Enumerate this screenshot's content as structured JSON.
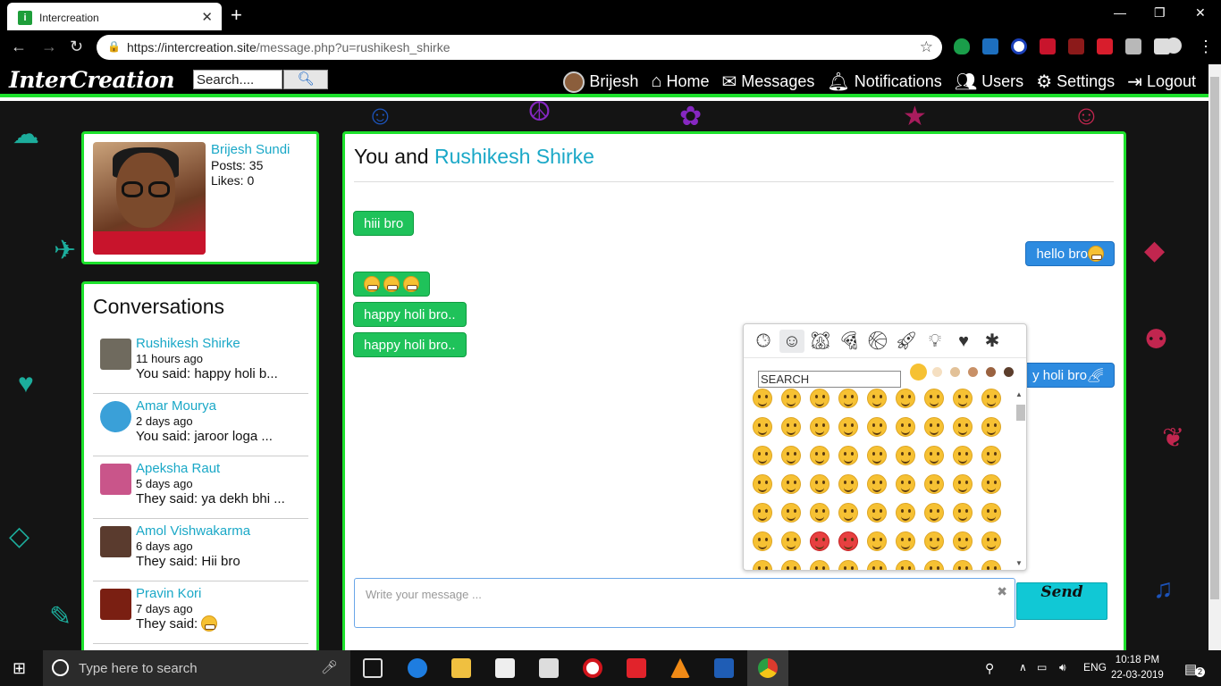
{
  "browser": {
    "tab_title": "Intercreation",
    "tab_icon_letter": "i",
    "url_host": "https://intercreation.site",
    "url_path": "/message.php?u=rushikesh_shirke"
  },
  "site": {
    "logo": "InterCreation",
    "search_placeholder": "Search....",
    "nav": [
      {
        "label": "Brijesh",
        "icon": "avatar"
      },
      {
        "label": "Home",
        "icon": "home-icon"
      },
      {
        "label": "Messages",
        "icon": "envelope-icon"
      },
      {
        "label": "Notifications",
        "icon": "bell-icon"
      },
      {
        "label": "Users",
        "icon": "users-icon"
      },
      {
        "label": "Settings",
        "icon": "gear-icon"
      },
      {
        "label": "Logout",
        "icon": "logout-icon"
      }
    ]
  },
  "profile": {
    "name": "Brijesh Sundi",
    "posts": "Posts: 35",
    "likes": "Likes: 0"
  },
  "conversations": {
    "title": "Conversations",
    "items": [
      {
        "name": "Rushikesh Shirke",
        "time": "11 hours ago",
        "snippet": "You said: happy holi b...",
        "avatar_color": "#6f6a5e"
      },
      {
        "name": "Amar Mourya",
        "time": "2 days ago",
        "snippet": "You said: jaroor loga ...",
        "avatar_color": "#3aa0d8"
      },
      {
        "name": "Apeksha Raut",
        "time": "5 days ago",
        "snippet": "They said: ya dekh bhi ...",
        "avatar_color": "#c9558a"
      },
      {
        "name": "Amol Vishwakarma",
        "time": "6 days ago",
        "snippet": "They said: Hii bro",
        "avatar_color": "#5a3b2e"
      },
      {
        "name": "Pravin Kori",
        "time": "7 days ago",
        "snippet": "They said:",
        "avatar_color": "#7a1f12"
      }
    ]
  },
  "chat": {
    "prefix": "You and",
    "partner": "Rushikesh Shirke",
    "messages": [
      {
        "dir": "in",
        "text": "hiii bro"
      },
      {
        "dir": "out",
        "text": "hello bro"
      },
      {
        "dir": "in",
        "text": ""
      },
      {
        "dir": "in",
        "text": "happy holi bro.."
      },
      {
        "dir": "in",
        "text": "happy holi bro.."
      },
      {
        "dir": "out",
        "text": "y holi bro"
      }
    ],
    "composer_placeholder": "Write your message ...",
    "send_label": "Send"
  },
  "emoji_picker": {
    "search_placeholder": "SEARCH",
    "categories": [
      "recent-icon",
      "smileys-icon",
      "animals-icon",
      "food-icon",
      "activity-icon",
      "travel-icon",
      "objects-icon",
      "symbols-icon",
      "flags-icon"
    ],
    "active_category": "smileys-icon",
    "skin_tones": [
      "#f6c133",
      "#f5dfc1",
      "#e2c198",
      "#c89067",
      "#9a6240",
      "#5c3e2c"
    ]
  },
  "taskbar": {
    "search_text": "Type here to search",
    "language": "ENG",
    "time": "10:18 PM",
    "date": "22-03-2019",
    "notification_count": "2"
  },
  "colors": {
    "accent_green": "#1de12c",
    "link_blue": "#1aa8c7",
    "incoming_bubble": "#1fc25a",
    "outgoing_bubble": "#2d8be0",
    "send_button": "#11c8d5"
  }
}
